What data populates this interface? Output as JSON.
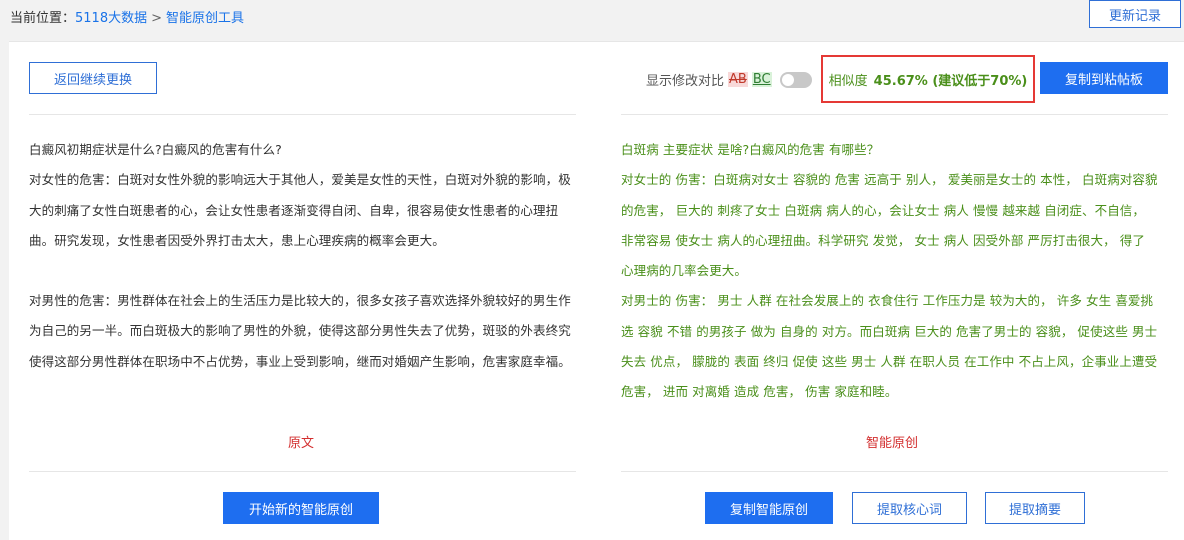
{
  "breadcrumb": {
    "prefix": "当前位置：",
    "link1": "5118大数据",
    "separator": ">",
    "link2": "智能原创工具"
  },
  "update_log_label": "更新记录",
  "toolbar": {
    "back_label": "返回继续更换",
    "diff_label": "显示修改对比",
    "diff_removed": "AB",
    "diff_added": "BC",
    "similarity_prefix": "相似度",
    "similarity_value": "45.67% (建议低于70%)",
    "copy_clipboard_label": "复制到粘帖板"
  },
  "original": {
    "paragraphs": [
      "白癜风初期症状是什么?白癜风的危害有什么?",
      "对女性的危害：白斑对女性外貌的影响远大于其他人，爱美是女性的天性，白斑对外貌的影响，极大的刺痛了女性白斑患者的心，会让女性患者逐渐变得自闭、自卑，很容易使女性患者的心理扭曲。研究发现，女性患者因受外界打击太大，患上心理疾病的概率会更大。",
      "",
      "对男性的危害：男性群体在社会上的生活压力是比较大的，很多女孩子喜欢选择外貌较好的男生作为自己的另一半。而白斑极大的影响了男性的外貌，使得这部分男性失去了优势，斑驳的外表终究使得这部分男性群体在职场中不占优势，事业上受到影响，继而对婚姻产生影响，危害家庭幸福。"
    ],
    "label": "原文"
  },
  "rewritten": {
    "paragraphs": [
      "白斑病 主要症状 是啥?白癜风的危害 有哪些？",
      "对女士的 伤害：白斑病对女士 容貌的 危害 远高于 别人， 爱美丽是女士的 本性， 白斑病对容貌的危害， 巨大的 刺疼了女士 白斑病 病人的心，会让女士 病人 慢慢 越来越 自闭症、不自信， 非常容易 使女士 病人的心理扭曲。科学研究 发觉， 女士 病人 因受外部 严厉打击很大， 得了 心理病的几率会更大。",
      "对男士的 伤害： 男士 人群 在社会发展上的 衣食住行 工作压力是 较为大的， 许多 女生 喜爱挑选 容貌 不错 的男孩子 做为 自身的 对方。而白斑病 巨大的 危害了男士的 容貌， 促使这些 男士 失去 优点， 朦胧的 表面 终归 促使 这些 男士 人群 在职人员 在工作中 不占上风，企事业上遭受 危害， 进而 对离婚 造成 危害， 伤害 家庭和睦。"
    ],
    "label": "智能原创"
  },
  "footer": {
    "new_rewrite_label": "开始新的智能原创",
    "copy_rewrite_label": "复制智能原创",
    "extract_keywords_label": "提取核心词",
    "extract_summary_label": "提取摘要"
  }
}
